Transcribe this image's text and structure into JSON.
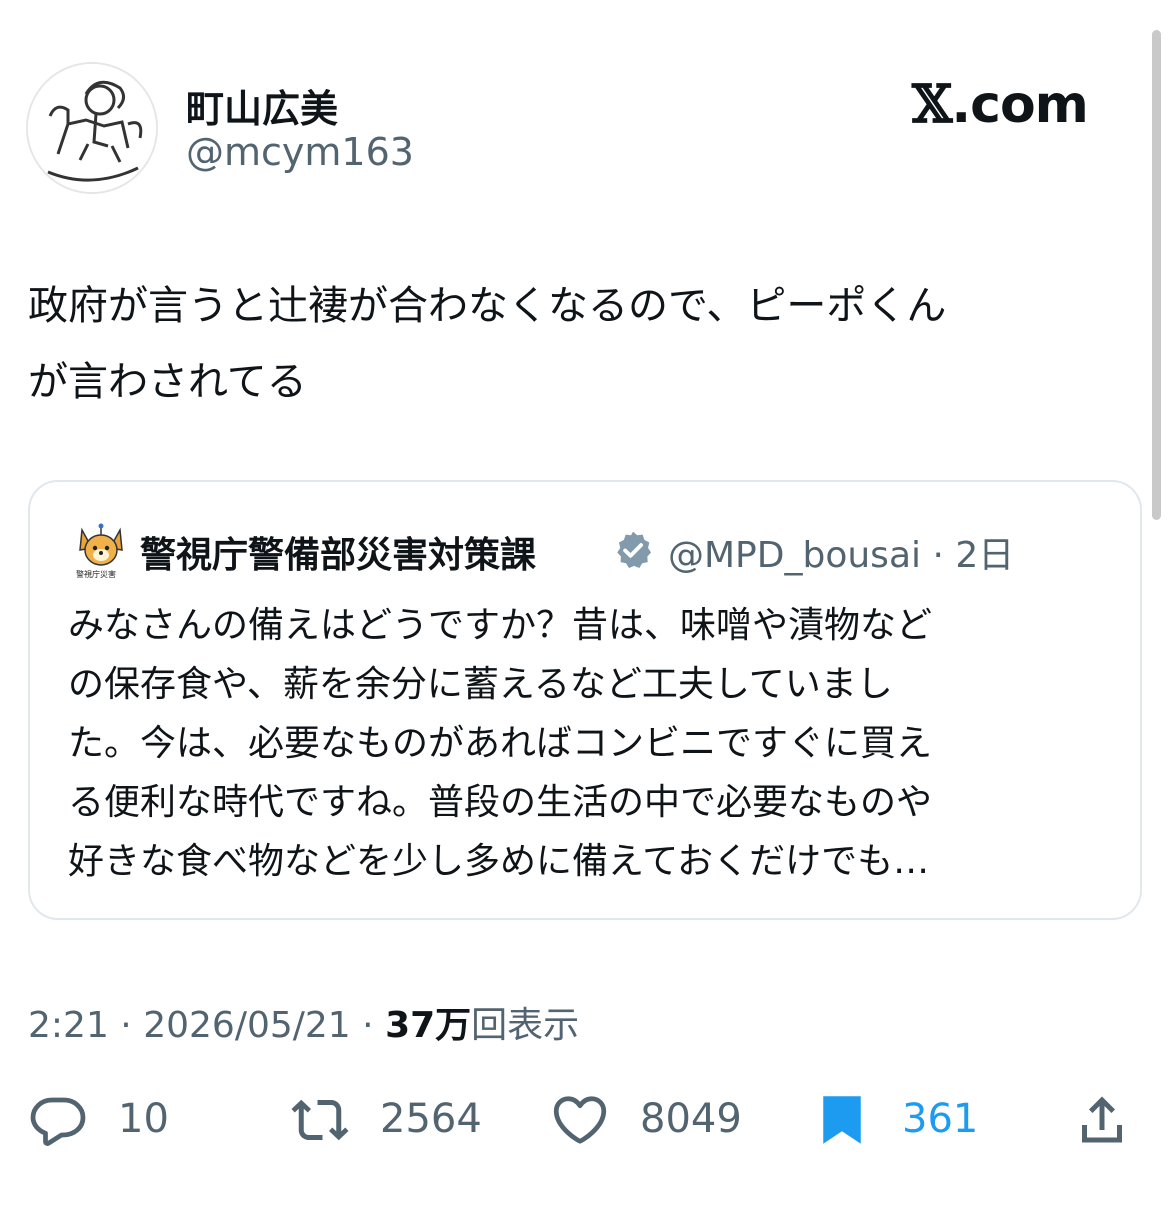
{
  "author": {
    "name": "町山広美",
    "handle": "@mcym163"
  },
  "site_logo": {
    "x": "𝕏",
    "rest": ".com"
  },
  "tweet": {
    "lines": [
      "政府が言うと辻褄が合わなくなるので、ピーポくん",
      "が言わされてる"
    ]
  },
  "quote": {
    "avatar_label": "警視庁災害",
    "name": "警視庁警備部災害対策課",
    "handle": "@MPD_bousai",
    "separator": "·",
    "time": "2日",
    "lines": [
      "みなさんの備えはどうですか？昔は、味噌や漬物など",
      "の保存食や、薪を余分に蓄えるなど工夫していまし",
      "た。今は、必要なものがあればコンビニですぐに買え",
      "る便利な時代ですね。普段の生活の中で必要なものや",
      "好きな食べ物などを少し多めに備えておくだけでも…"
    ]
  },
  "meta": {
    "time": "2:21",
    "sep": "·",
    "date": "2026/05/21",
    "views_count": "37万",
    "views_label": "回表示"
  },
  "actions": {
    "replies": "10",
    "reposts": "2564",
    "likes": "8049",
    "bookmarks": "361"
  },
  "icons": [
    "reply-icon",
    "repost-icon",
    "like-icon",
    "bookmark-icon",
    "share-icon",
    "verified-badge-icon"
  ],
  "colors": {
    "bookmark_active": "#1d9bf0",
    "text_secondary": "#536471"
  }
}
